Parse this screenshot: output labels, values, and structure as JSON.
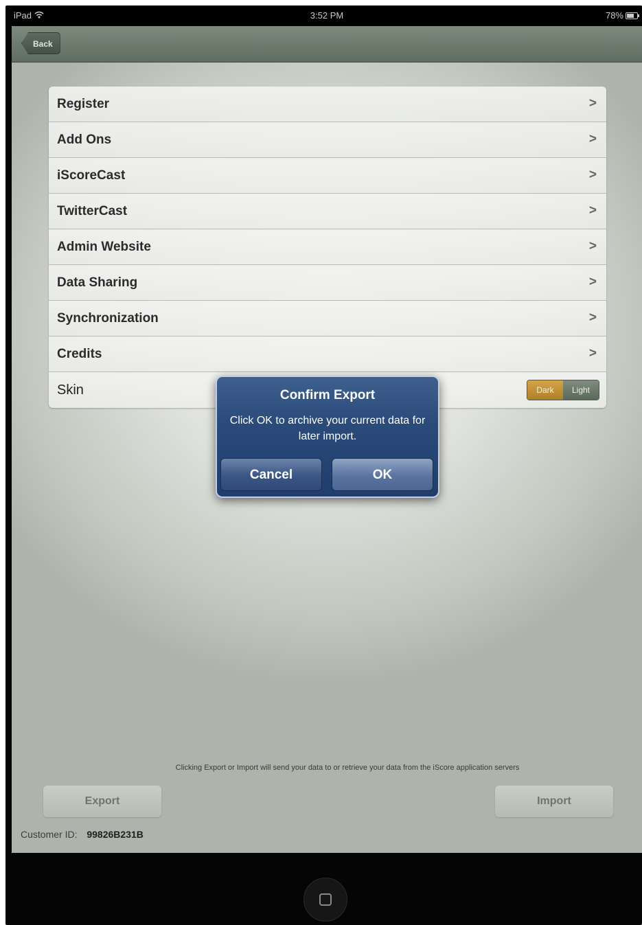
{
  "status_bar": {
    "device": "iPad",
    "time": "3:52 PM",
    "battery": "78%"
  },
  "nav": {
    "back_label": "Back"
  },
  "menu": {
    "items": [
      {
        "label": "Register",
        "chevron": ">"
      },
      {
        "label": "Add Ons",
        "chevron": ">"
      },
      {
        "label": "iScoreCast",
        "chevron": ">"
      },
      {
        "label": "TwitterCast",
        "chevron": ">"
      },
      {
        "label": "Admin Website",
        "chevron": ">"
      },
      {
        "label": "Data Sharing",
        "chevron": ">"
      },
      {
        "label": "Synchronization",
        "chevron": ">"
      },
      {
        "label": "Credits",
        "chevron": ">"
      }
    ],
    "skin": {
      "label": "Skin",
      "options": [
        "Dark",
        "Light"
      ],
      "selected": "Dark"
    }
  },
  "alert": {
    "title": "Confirm Export",
    "message": "Click OK to archive your current data for later import.",
    "cancel_label": "Cancel",
    "ok_label": "OK"
  },
  "footer": {
    "disclaimer": "Clicking Export or Import will send your data to or retrieve your data from the iScore application servers",
    "export_label": "Export",
    "import_label": "Import",
    "customer_id_label": "Customer ID:",
    "customer_id_value": "99826B231B"
  },
  "colors": {
    "nav_bar": "#6b7a6c",
    "alert_bg": "#2a4a7a",
    "skin_dark": "#c49238",
    "skin_light": "#6f7d6f"
  }
}
